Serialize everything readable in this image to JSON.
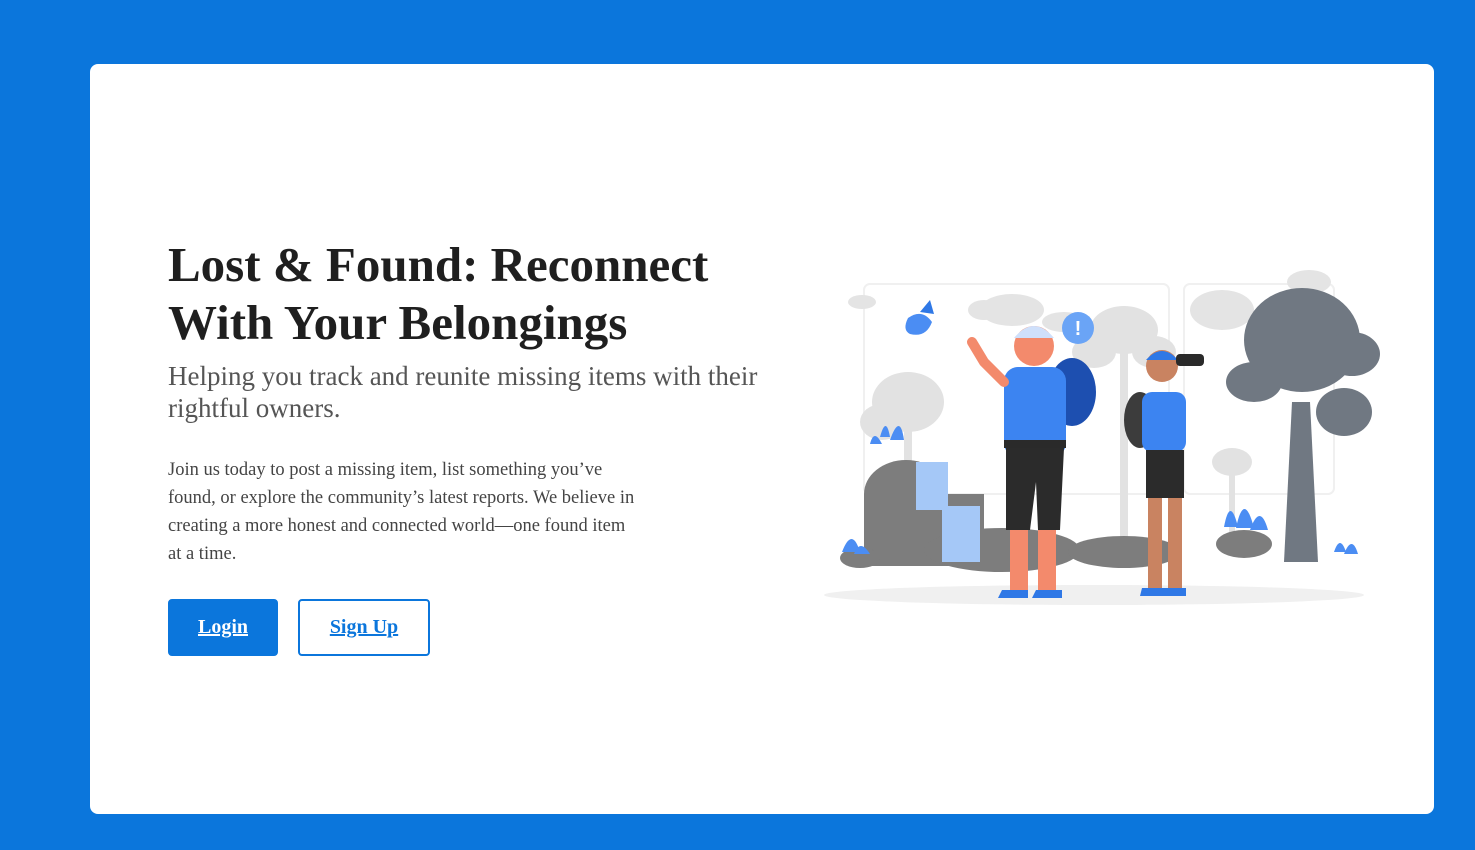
{
  "hero": {
    "title": "Lost & Found: Reconnect With Your Belongings",
    "subtitle": "Helping you track and reunite missing items with their rightful owners.",
    "description": "Join us today to post a missing item, list something you’ve found, or explore the community’s latest reports. We believe in creating a more honest and connected world—one found item at a time."
  },
  "buttons": {
    "login_label": "Login",
    "signup_label": "Sign Up"
  },
  "illustration": {
    "icon": "hikers-illustration",
    "alert_glyph": "!"
  },
  "colors": {
    "background": "#0b76dc",
    "card": "#ffffff",
    "accent": "#0b76dc",
    "heading": "#1f1f1f",
    "subtitle": "#555555"
  }
}
